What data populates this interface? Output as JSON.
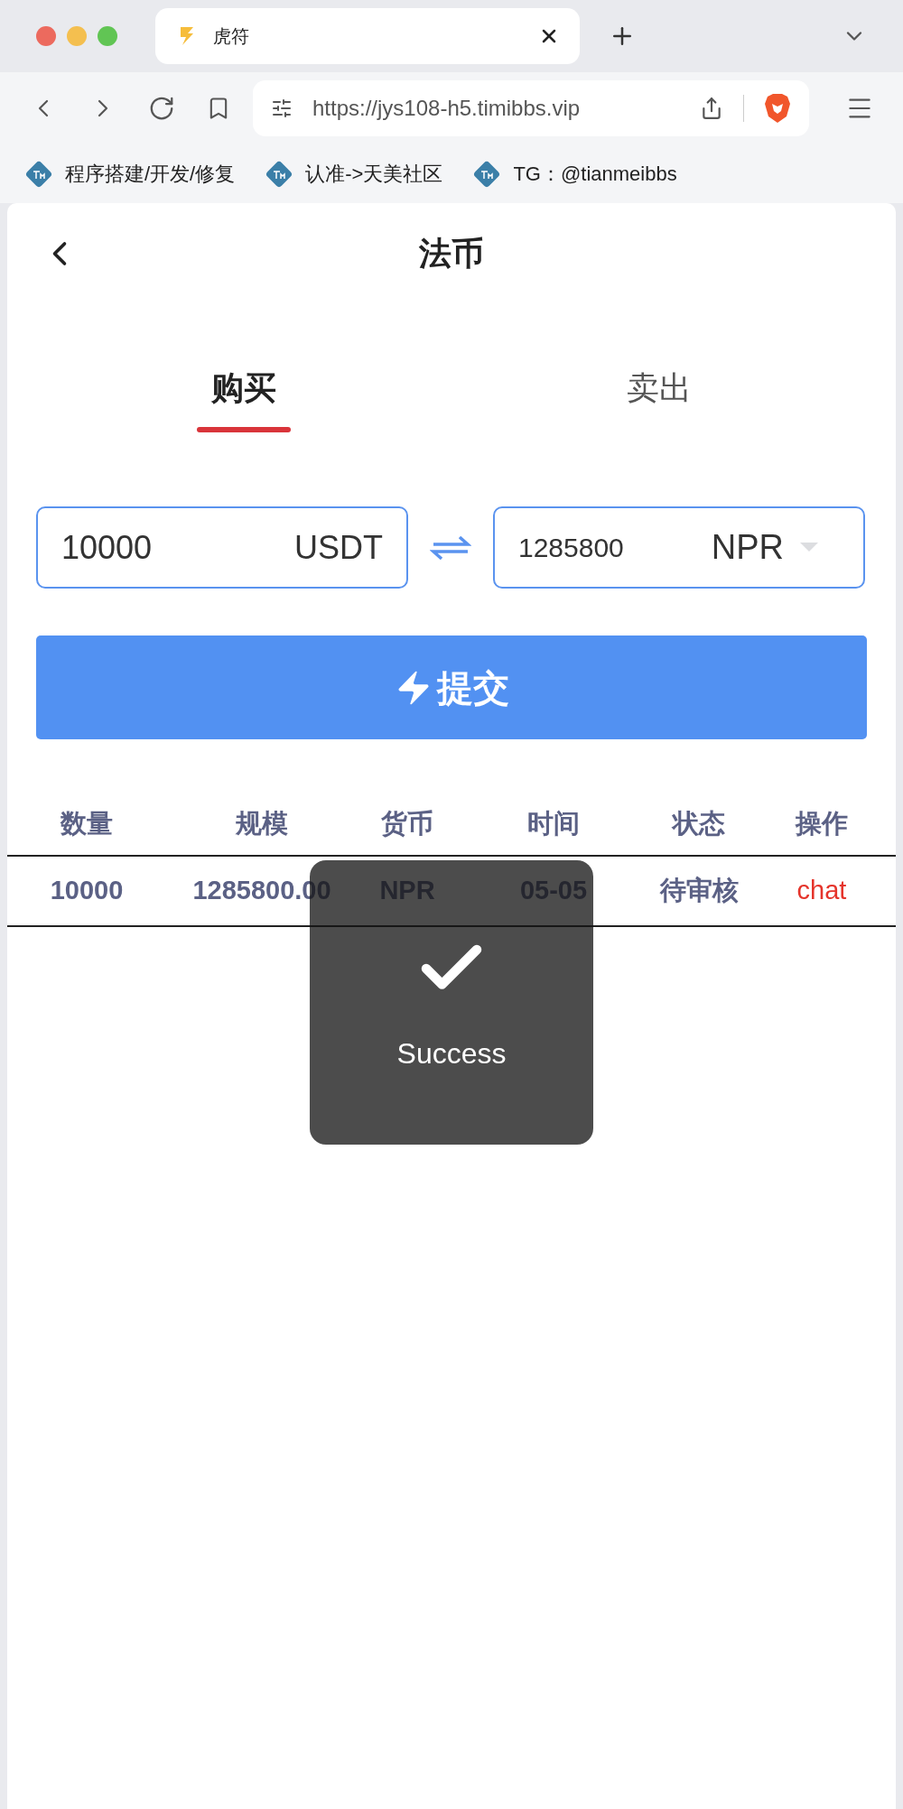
{
  "browser": {
    "tabs": [
      {
        "title": "虎符",
        "selected": true
      }
    ],
    "url": "https://jys108-h5.timibbs.vip",
    "bookmarks": [
      "程序搭建/开发/修复",
      "认准->天美社区",
      "TG：@tianmeibbs"
    ]
  },
  "page": {
    "title": "法币",
    "tabs": [
      {
        "label": "购买",
        "selected": true
      },
      {
        "label": "卖出",
        "selected": false
      }
    ],
    "amount_field": {
      "value": "10000",
      "unit": "USDT"
    },
    "converted_field": {
      "value": "1285800",
      "currency": "NPR"
    },
    "submit_button": "提交",
    "table": {
      "columns": [
        "数量",
        "规模",
        "货币",
        "时间",
        "状态",
        "操作"
      ],
      "rows": [
        {
          "cells": [
            "10000",
            "1285800.00",
            "NPR",
            "05-05",
            "待审核"
          ],
          "action": "chat"
        }
      ]
    },
    "toast": {
      "message": "Success"
    }
  }
}
